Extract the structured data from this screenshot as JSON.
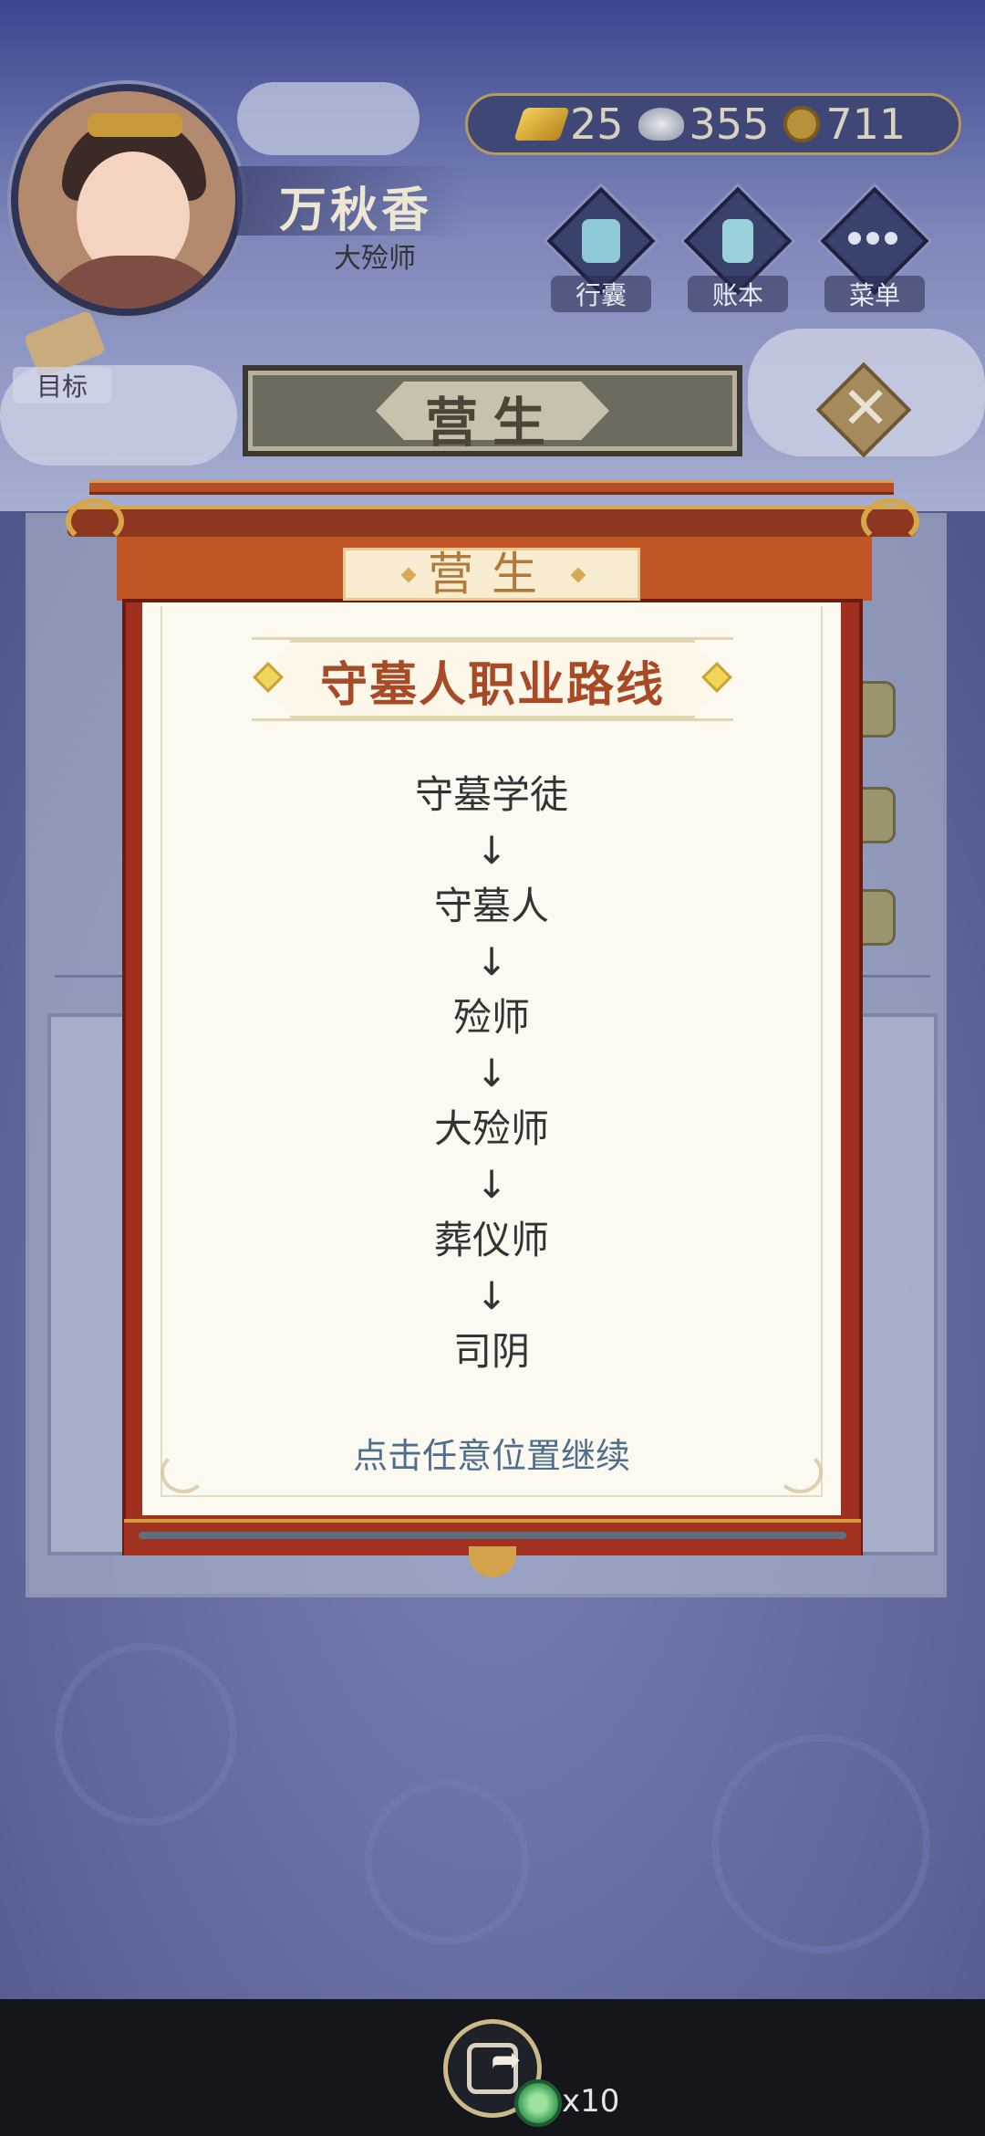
{
  "character": {
    "name": "万秋香",
    "title": "大殓师"
  },
  "currency": {
    "gold": "25",
    "silver": "355",
    "coin": "711"
  },
  "top_buttons": {
    "bag": "行囊",
    "ledger": "账本",
    "menu": "菜单"
  },
  "goal_label": "目标",
  "header_title": "营生",
  "modal": {
    "tab_label": "营生",
    "route_title": "守墓人职业路线",
    "path": [
      "守墓学徒",
      "↓",
      "守墓人",
      "↓",
      "殓师",
      "↓",
      "大殓师",
      "↓",
      "葬仪师",
      "↓",
      "司阴"
    ],
    "continue_hint": "点击任意位置继续"
  },
  "share": {
    "reward_count": "x10"
  },
  "colors": {
    "accent_red": "#9f2f1f",
    "title_orange": "#a84a26",
    "gold_trim": "#d6a64a"
  }
}
